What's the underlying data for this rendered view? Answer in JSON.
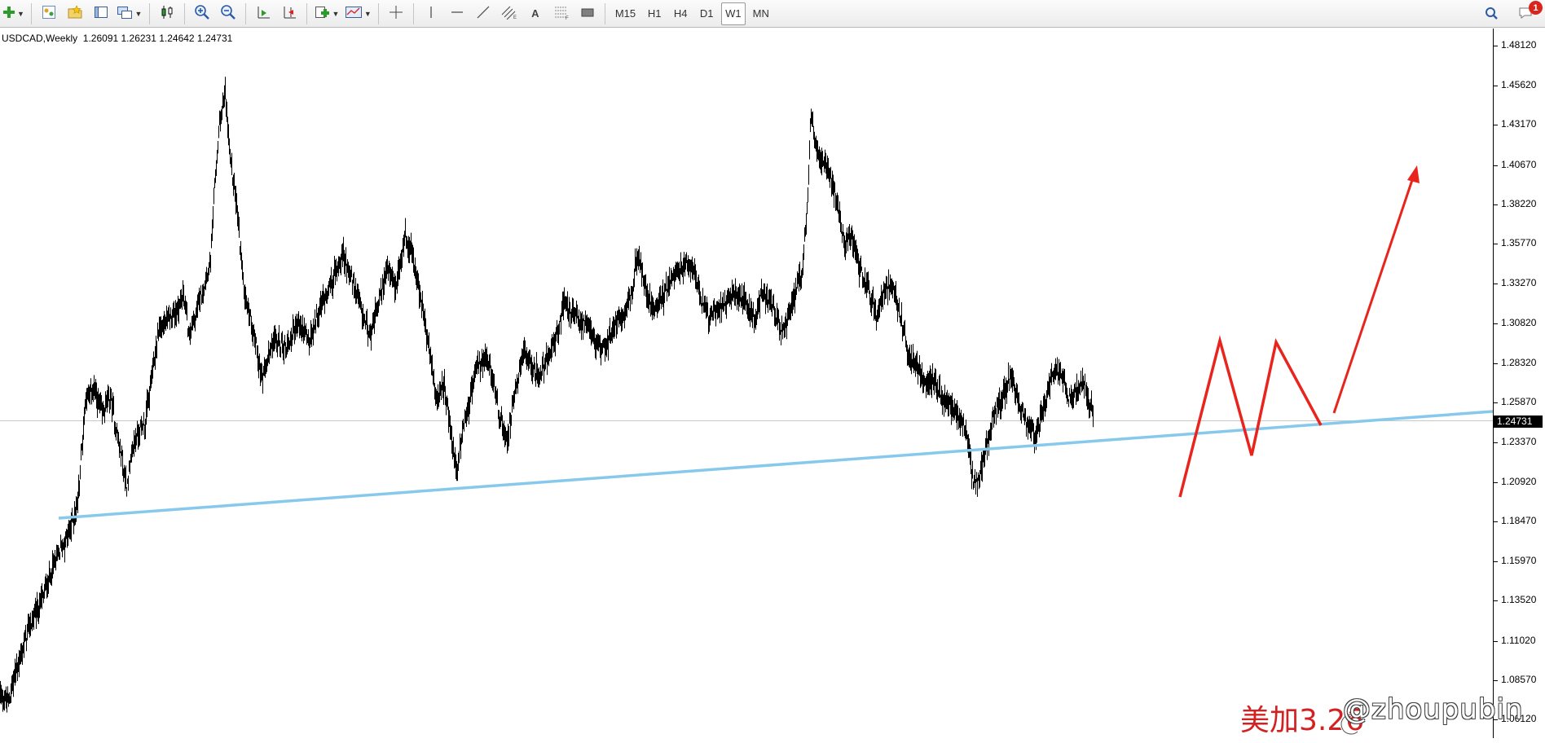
{
  "toolbar": {
    "timeframes": [
      {
        "label": "M15",
        "active": false
      },
      {
        "label": "H1",
        "active": false
      },
      {
        "label": "H4",
        "active": false
      },
      {
        "label": "D1",
        "active": false
      },
      {
        "label": "W1",
        "active": true
      },
      {
        "label": "MN",
        "active": false
      }
    ],
    "text_tool_label": "A",
    "notification_count": "1"
  },
  "chart": {
    "header": "USDCAD,Weekly  1.26091 1.26231 1.24642 1.24731",
    "current_price": "1.24731",
    "price_axis": [
      "1.48120",
      "1.45620",
      "1.43170",
      "1.40670",
      "1.38220",
      "1.35770",
      "1.33270",
      "1.30820",
      "1.28320",
      "1.25870",
      "1.23370",
      "1.20920",
      "1.18470",
      "1.15970",
      "1.13520",
      "1.11020",
      "1.08570",
      "1.06120"
    ],
    "colors": {
      "candles": "#000000",
      "trendline": "#87c9ec",
      "annotation": "#e8241c",
      "price_line": "#c8c8c8"
    },
    "annotation_text": "美加3.26",
    "watermark": "@zhoupubin"
  },
  "chart_data": {
    "type": "candlestick",
    "symbol": "USDCAD",
    "timeframe": "Weekly",
    "last": {
      "open": 1.26091,
      "high": 1.26231,
      "low": 1.24642,
      "close": 1.24731
    },
    "ylim": [
      1.055,
      1.49
    ],
    "anchors": [
      [
        0,
        1.076
      ],
      [
        10,
        1.072
      ],
      [
        20,
        1.093
      ],
      [
        35,
        1.118
      ],
      [
        50,
        1.135
      ],
      [
        62,
        1.152
      ],
      [
        75,
        1.168
      ],
      [
        85,
        1.178
      ],
      [
        95,
        1.197
      ],
      [
        105,
        1.262
      ],
      [
        115,
        1.268
      ],
      [
        125,
        1.252
      ],
      [
        135,
        1.262
      ],
      [
        145,
        1.235
      ],
      [
        155,
        1.207
      ],
      [
        165,
        1.236
      ],
      [
        178,
        1.247
      ],
      [
        185,
        1.272
      ],
      [
        195,
        1.305
      ],
      [
        205,
        1.309
      ],
      [
        215,
        1.315
      ],
      [
        225,
        1.326
      ],
      [
        232,
        1.299
      ],
      [
        245,
        1.324
      ],
      [
        258,
        1.347
      ],
      [
        264,
        1.402
      ],
      [
        270,
        1.437
      ],
      [
        276,
        1.451
      ],
      [
        282,
        1.41
      ],
      [
        290,
        1.382
      ],
      [
        298,
        1.333
      ],
      [
        310,
        1.305
      ],
      [
        322,
        1.272
      ],
      [
        335,
        1.298
      ],
      [
        350,
        1.292
      ],
      [
        365,
        1.308
      ],
      [
        380,
        1.296
      ],
      [
        395,
        1.322
      ],
      [
        410,
        1.338
      ],
      [
        420,
        1.352
      ],
      [
        432,
        1.334
      ],
      [
        445,
        1.312
      ],
      [
        455,
        1.302
      ],
      [
        465,
        1.322
      ],
      [
        475,
        1.343
      ],
      [
        485,
        1.328
      ],
      [
        497,
        1.363
      ],
      [
        505,
        1.352
      ],
      [
        512,
        1.333
      ],
      [
        520,
        1.312
      ],
      [
        528,
        1.286
      ],
      [
        535,
        1.262
      ],
      [
        545,
        1.268
      ],
      [
        555,
        1.232
      ],
      [
        560,
        1.215
      ],
      [
        567,
        1.241
      ],
      [
        575,
        1.258
      ],
      [
        585,
        1.282
      ],
      [
        600,
        1.283
      ],
      [
        612,
        1.251
      ],
      [
        622,
        1.236
      ],
      [
        632,
        1.264
      ],
      [
        642,
        1.292
      ],
      [
        652,
        1.282
      ],
      [
        662,
        1.274
      ],
      [
        672,
        1.288
      ],
      [
        682,
        1.298
      ],
      [
        692,
        1.321
      ],
      [
        705,
        1.312
      ],
      [
        718,
        1.308
      ],
      [
        730,
        1.296
      ],
      [
        742,
        1.292
      ],
      [
        755,
        1.309
      ],
      [
        765,
        1.316
      ],
      [
        775,
        1.328
      ],
      [
        782,
        1.351
      ],
      [
        790,
        1.333
      ],
      [
        800,
        1.318
      ],
      [
        812,
        1.322
      ],
      [
        822,
        1.336
      ],
      [
        832,
        1.339
      ],
      [
        842,
        1.344
      ],
      [
        852,
        1.342
      ],
      [
        860,
        1.324
      ],
      [
        870,
        1.312
      ],
      [
        880,
        1.316
      ],
      [
        892,
        1.323
      ],
      [
        902,
        1.326
      ],
      [
        915,
        1.321
      ],
      [
        925,
        1.312
      ],
      [
        935,
        1.326
      ],
      [
        948,
        1.318
      ],
      [
        958,
        1.302
      ],
      [
        968,
        1.312
      ],
      [
        978,
        1.329
      ],
      [
        985,
        1.345
      ],
      [
        990,
        1.378
      ],
      [
        995,
        1.438
      ],
      [
        1000,
        1.418
      ],
      [
        1008,
        1.412
      ],
      [
        1018,
        1.402
      ],
      [
        1028,
        1.382
      ],
      [
        1035,
        1.358
      ],
      [
        1045,
        1.362
      ],
      [
        1055,
        1.341
      ],
      [
        1065,
        1.331
      ],
      [
        1075,
        1.312
      ],
      [
        1085,
        1.328
      ],
      [
        1095,
        1.333
      ],
      [
        1105,
        1.312
      ],
      [
        1115,
        1.288
      ],
      [
        1125,
        1.281
      ],
      [
        1135,
        1.272
      ],
      [
        1145,
        1.273
      ],
      [
        1155,
        1.262
      ],
      [
        1165,
        1.256
      ],
      [
        1175,
        1.252
      ],
      [
        1185,
        1.241
      ],
      [
        1193,
        1.212
      ],
      [
        1200,
        1.208
      ],
      [
        1210,
        1.232
      ],
      [
        1220,
        1.252
      ],
      [
        1230,
        1.262
      ],
      [
        1240,
        1.276
      ],
      [
        1250,
        1.258
      ],
      [
        1260,
        1.247
      ],
      [
        1270,
        1.239
      ],
      [
        1280,
        1.255
      ],
      [
        1290,
        1.274
      ],
      [
        1300,
        1.281
      ],
      [
        1310,
        1.262
      ],
      [
        1320,
        1.266
      ],
      [
        1330,
        1.271
      ],
      [
        1340,
        1.252
      ]
    ]
  }
}
